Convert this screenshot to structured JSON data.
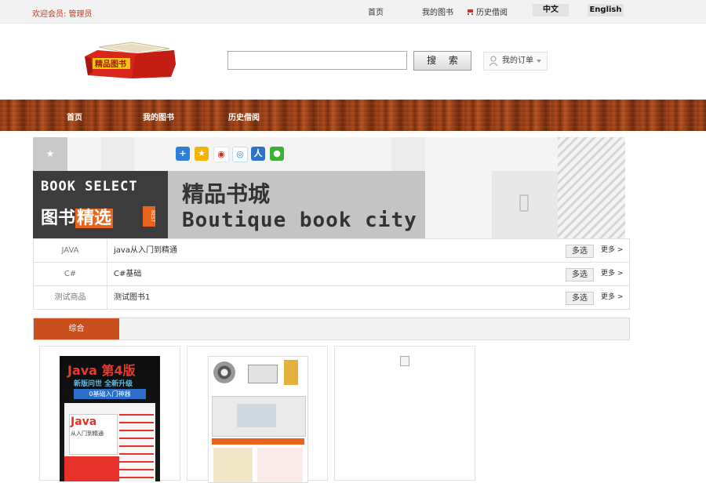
{
  "topbar": {
    "welcome": "欢迎会员: 管理员",
    "links": [
      "首页",
      "我的图书",
      "历史借阅"
    ],
    "lang_cn": "中文",
    "lang_en": "English"
  },
  "header": {
    "logo_text": "精品图书",
    "search_button": "搜 索",
    "search_value": "",
    "my_orders": "我的订单"
  },
  "nav": {
    "items": [
      "首页",
      "我的图书",
      "历史借阅"
    ]
  },
  "banner": {
    "book_select": "BOOK SELECT",
    "tushu": "图书",
    "jingxuan": "精选",
    "best": "BEST",
    "title_cn": "精品书城",
    "title_en": "Boutique book city",
    "share_icons": [
      "add-share-icon",
      "qzone-icon",
      "weibo-icon",
      "tencent-weibo-icon",
      "renren-icon",
      "wechat-icon"
    ]
  },
  "categories": [
    {
      "name": "JAVA",
      "book": "java从入门到精通",
      "multi": "多选",
      "more": "更多 >"
    },
    {
      "name": "C#",
      "book": "C#基础",
      "multi": "多选",
      "more": "更多 >"
    },
    {
      "name": "测试商品",
      "book": "测试图书1",
      "multi": "多选",
      "more": "更多 >"
    }
  ],
  "tabs": {
    "active": "综合"
  },
  "products": [
    {
      "cover_title": "Java 第4版",
      "cover_sub": "新版问世 全新升级",
      "cover_tag": "0基础入门神器",
      "cover_name": "Java",
      "cover_name2": "从入门到精通"
    },
    {
      "cover": "multimedia-bundle"
    },
    {
      "cover": "broken-image"
    }
  ],
  "colors": {
    "accent": "#c9501c",
    "welcome_red": "#c0392b",
    "nav_wood": "#8b3a14"
  }
}
